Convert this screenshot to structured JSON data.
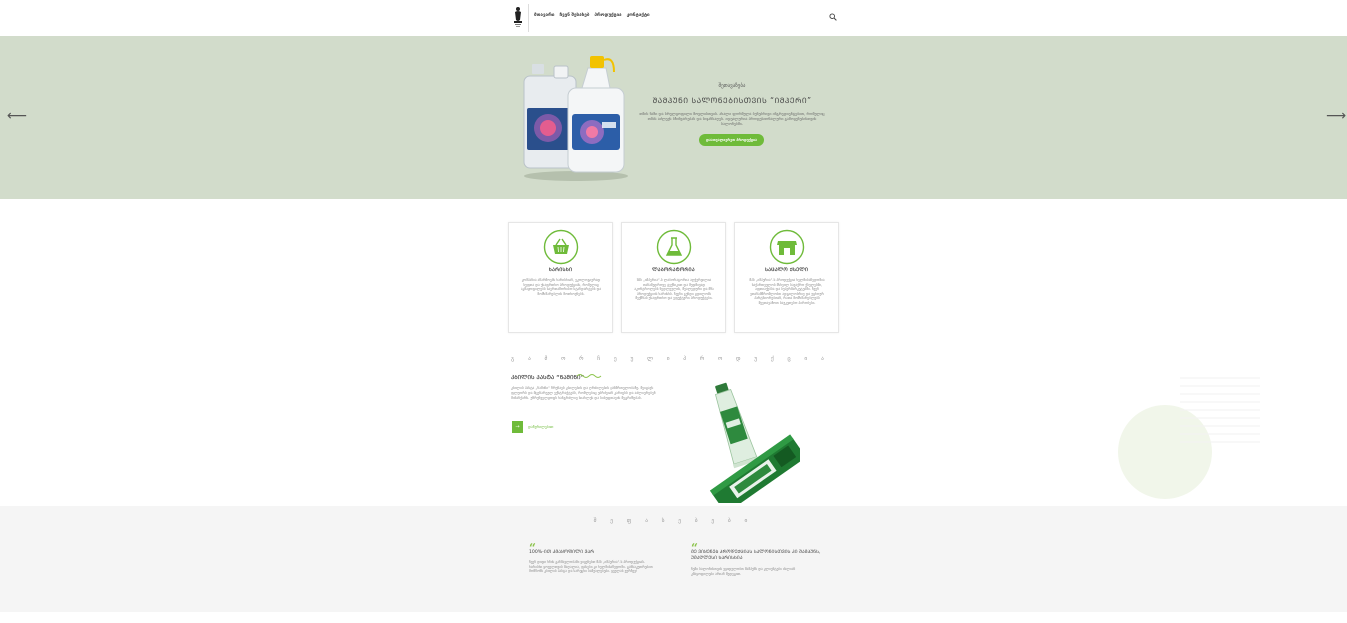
{
  "header": {
    "logo_alt": "logo",
    "nav": [
      "მთავარი",
      "ჩვენ შესახებ",
      "პროდუქცია",
      "კონტაქტი"
    ],
    "search_icon": "search-icon"
  },
  "hero": {
    "eyebrow": "შეთავაზება",
    "title": "ᲨᲐᲛᲞᲣᲜᲘ ᲡᲐᲚᲝᲜᲔᲑᲘᲡᲗᲕᲘᲡ “ᲘᲛᲞᲔᲠᲘ”",
    "text": "თმის ნაზი და სრულყოფილი მოვლისთვის. ახალი ფორმულა ბუნებრივი ინგრედიენტებით, რომელიც თმას აძლევს ბზინვარებას და სიჯანსაღეს. იდეალურია პროფესიონალური გამოყენებისთვის სალონებში.",
    "button": "დაათვალიერეთ პროდუქცია",
    "colors": {
      "background": "#d2dccb",
      "accent": "#6fbb3a"
    }
  },
  "features": [
    {
      "icon": "basket-icon",
      "title": "ᲮᲐᲠᲘᲡᲮᲘ",
      "text": "კომპანია აწარმოებს ხარისხიან, ეკოლოგიურად სუფთა და უსაფრთხო პროდუქციას, რომელიც აკმაყოფილებს საერთაშორისო სტანდარტებს და მომხმარებლის მოთხოვნებს."
    },
    {
      "icon": "flask-icon",
      "title": "ᲚᲐᲑᲝᲠᲐᲢᲝᲠᲘᲐ",
      "text": "შპს „იმპერია“-ს ლაბორატორია აღჭურვილია თანამედროვე ტექნიკით და მუდმივად აკონტროლებს ნედლეულის, შუალედური და მზა პროდუქციის ხარისხს. ჩვენი გუნდი ცდილობს შექმნას უსაფრთხო და ეფექტური პროდუქტები."
    },
    {
      "icon": "store-icon",
      "title": "ᲡᲐᲪᲐᲚᲝ ᲥᲡᲔᲚᲘ",
      "text": "შპს „იმპერია“-ს პროდუქცია ხელმისაწვდომია საქართველოს მსხვილ სავაჭრო ქსელებში, აფთიაქებსა და სუპერმარკეტებში. ჩვენ ვთანამშრომლობთ ადგილობრივ და უცხოურ პარტნიორებთან, რათა მომხმარებლებს შევთავაზოთ საუკეთესო პირობები."
    }
  ],
  "featured": {
    "section_title": "გ ა მ ო რ ჩ ე უ ლ ი   პ რ ო დ უ ქ ც ი ა",
    "product_title": "ᲙᲑᲘᲚᲘᲡ ᲞᲐᲡᲢᲐ “ᲜᲐᲛᲘᲜᲘ”",
    "description": "კბილის პასტა „ნამინი“ ზრუნავს კბილების და ღრძილების ჯანმრთელობაზე. შეიცავს ფლუორს და მცენარეულ ექსტრაქტებს, რომლებიც ებრძვიან კარიესს და აძლიერებენ მინანქარს. უზრუნველყოფს ხანგრძლივ სიახლეს და სისუფთავის შეგრძნებას.",
    "more_button": "→",
    "more_link": "დაწვრილებით",
    "product_icon": "toothpaste-icon"
  },
  "testimonials": {
    "section_title": "შ ე ფ ა ს ე ბ ე ბ ი",
    "items": [
      {
        "name": "100%-ᲘᲗ ᲙᲛᲐᲧᲝᲤᲘᲚᲘ ᲕᲐᲠ",
        "text": "ჩვენ დიდი ხნის განმავლობაში ვიყენებთ შპს „იმპერია“-ს პროდუქციას. ხარისხი ყოველთვის მაღალია, ფასები კი ხელმისაწვდომი. განსაკუთრებით მომწონს კბილის პასტა და სარეცხი საშუალებები. ყველას ვურჩევ!"
      },
      {
        "name": "ᲛᲔ ᲕᲘᲧᲔᲜᲔᲑ ᲞᲠᲝᲓᲣᲥᲪᲘᲐᲡ ᲡᲐᲚᲝᲜᲘᲡᲗᲕᲘᲡ ᲙᲘ ᲨᲐᲛᲞᲣᲜᲡ, ᲣᲛᲐᲦᲚᲔᲡᲘ ᲮᲐᲠᲘᲡᲮᲘᲐ",
        "text": "ჩემი სალონისთვის ვყიდულობთ შამპუნს და კლიენტები ძალიან კმაყოფილები არიან შედეგით."
      }
    ]
  }
}
